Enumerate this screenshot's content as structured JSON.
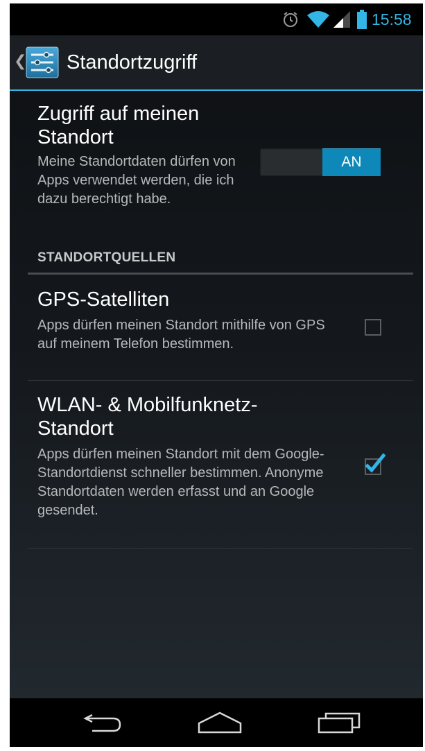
{
  "status_bar": {
    "time": "15:58",
    "icons": [
      "alarm-icon",
      "wifi-icon",
      "signal-icon",
      "battery-icon"
    ],
    "accent_color": "#33b5e5"
  },
  "action_bar": {
    "title": "Standortzugriff",
    "icon": "settings-sliders-icon"
  },
  "location_access": {
    "title": "Zugriff auf meinen Standort",
    "summary": "Meine Standortdaten dürfen von Apps verwendet werden, die ich dazu berechtigt habe.",
    "toggle_label": "AN",
    "toggle_on": true
  },
  "sources": {
    "header": "STANDORTQUELLEN",
    "items": [
      {
        "title": "GPS-Satelliten",
        "summary": "Apps dürfen meinen Standort mithilfe von GPS auf meinem Telefon bestimmen.",
        "checked": false
      },
      {
        "title": "WLAN- & Mobilfunknetz-Standort",
        "summary": "Apps dürfen meinen Standort mit dem Google-Standortdienst schneller bestimmen. Anonyme Standortdaten werden erfasst und an Google gesendet.",
        "checked": true
      }
    ]
  },
  "nav_bar": {
    "buttons": [
      "back-icon",
      "home-icon",
      "recents-icon"
    ]
  }
}
